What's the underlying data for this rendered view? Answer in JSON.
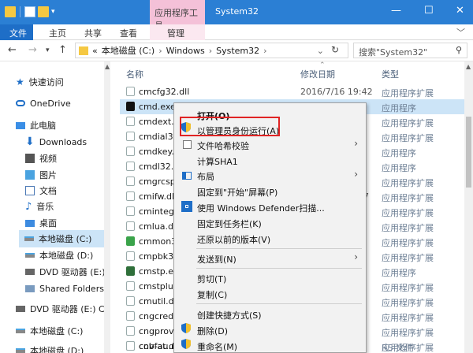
{
  "title_bar": {
    "tool_tab": "应用程序工具",
    "window_title": "System32",
    "controls": [
      "—",
      "☐",
      "✕"
    ]
  },
  "ribbon": {
    "tabs": [
      "文件",
      "主页",
      "共享",
      "查看",
      "管理"
    ],
    "expand_icon": "chevron-down-icon"
  },
  "address": {
    "breadcrumb": [
      "«",
      "本地磁盘 (C:)",
      "Windows",
      "System32"
    ],
    "search_placeholder": "搜索\"System32\""
  },
  "nav": {
    "items": [
      {
        "label": "快速访问",
        "icon": "star-icon"
      },
      {
        "label": "OneDrive",
        "icon": "cloud-icon"
      },
      {
        "label": "此电脑",
        "icon": "pc-icon"
      },
      {
        "label": "Downloads",
        "icon": "download-icon"
      },
      {
        "label": "视频",
        "icon": "video-icon"
      },
      {
        "label": "图片",
        "icon": "picture-icon"
      },
      {
        "label": "文档",
        "icon": "document-icon"
      },
      {
        "label": "音乐",
        "icon": "music-icon"
      },
      {
        "label": "桌面",
        "icon": "desktop-icon"
      },
      {
        "label": "本地磁盘 (C:)",
        "icon": "drive-icon",
        "selected": true
      },
      {
        "label": "本地磁盘 (D:)",
        "icon": "drive-icon"
      },
      {
        "label": "DVD 驱动器 (E:)",
        "icon": "dvd-icon"
      },
      {
        "label": "Shared Folders",
        "icon": "share-icon"
      },
      {
        "label": "DVD 驱动器 (E:) C",
        "icon": "dvd-icon"
      },
      {
        "label": "本地磁盘 (C:)",
        "icon": "drive-icon"
      },
      {
        "label": "本地磁盘 (D:)",
        "icon": "drive-icon"
      }
    ]
  },
  "columns": {
    "name": "名称",
    "date": "修改日期",
    "type": "类型"
  },
  "files": [
    {
      "name": "cmcfg32.dll",
      "date": "2016/7/16 19:42",
      "type": "应用程序扩展"
    },
    {
      "name": "cmd.exe",
      "date": "",
      "type": "应用程序",
      "selected": true
    },
    {
      "name": "cmdext.d",
      "date": "",
      "type": "应用程序扩展"
    },
    {
      "name": "cmdial32",
      "date": "",
      "type": "应用程序扩展"
    },
    {
      "name": "cmdkey.e",
      "date": "",
      "type": "应用程序"
    },
    {
      "name": "cmdl32.e",
      "date": "",
      "type": "应用程序"
    },
    {
      "name": "cmgrcsp",
      "date": "",
      "type": "应用程序扩展"
    },
    {
      "name": "cmifw.dll",
      "date": "7",
      "type": "应用程序扩展"
    },
    {
      "name": "cmintegr",
      "date": "",
      "type": "应用程序扩展"
    },
    {
      "name": "cmlua.dll",
      "date": "",
      "type": "应用程序扩展"
    },
    {
      "name": "cmmon3",
      "date": "",
      "type": "应用程序扩展"
    },
    {
      "name": "cmpbk32",
      "date": "",
      "type": "应用程序扩展"
    },
    {
      "name": "cmstp.ex",
      "date": "",
      "type": "应用程序"
    },
    {
      "name": "cmstplua",
      "date": "",
      "type": "应用程序扩展"
    },
    {
      "name": "cmutil.dl",
      "date": "",
      "type": "应用程序扩展"
    },
    {
      "name": "cngcredu",
      "date": "",
      "type": "应用程序扩展"
    },
    {
      "name": "cngprovi",
      "date": "",
      "type": "应用程序扩展"
    },
    {
      "name": "cnvfat.dl",
      "date": "",
      "type": "应用程序扩展"
    },
    {
      "name": "cob-au.rs",
      "date": "",
      "type": "RS 文件"
    }
  ],
  "context_menu": {
    "open": "打开(O)",
    "run_as_admin": "以管理员身份运行(A)",
    "hash_check": "文件哈希校验",
    "sha1": "计算SHA1",
    "layout": "布局",
    "pin_start": "固定到\"开始\"屏幕(P)",
    "defender": "使用 Windows Defender扫描...",
    "pin_taskbar": "固定到任务栏(K)",
    "restore": "还原以前的版本(V)",
    "send_to": "发送到(N)",
    "cut": "剪切(T)",
    "copy": "复制(C)",
    "shortcut": "创建快捷方式(S)",
    "delete": "删除(D)",
    "rename": "重命名(M)"
  },
  "colors": {
    "titlebar": "#2b7fd4",
    "tool_tab": "#f4c1d8",
    "selection": "#cce4f7",
    "highlight_border": "#e02424"
  }
}
